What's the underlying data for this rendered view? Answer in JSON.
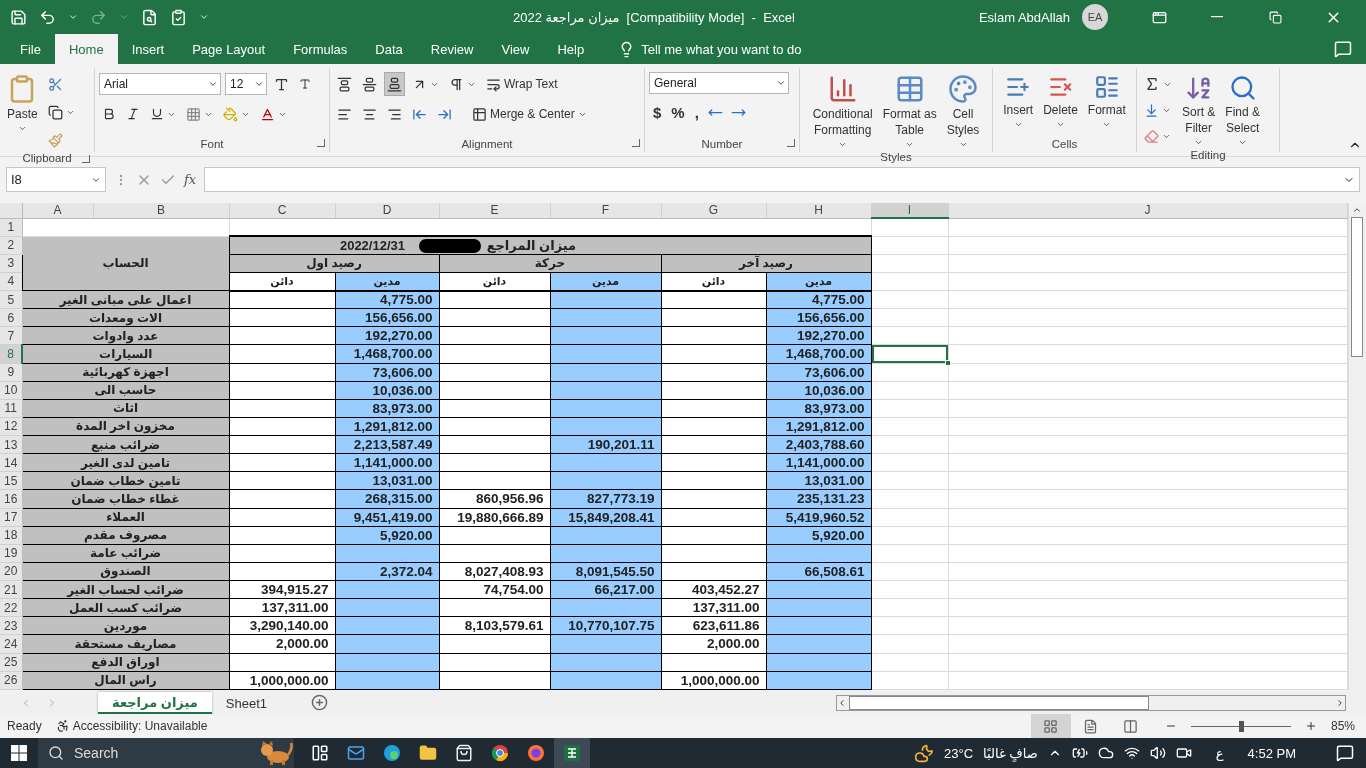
{
  "title_bar": {
    "title": "ميزان مراجعة 2022  [Compatibility Mode]  -  Excel",
    "user": "Eslam AbdAllah",
    "avatar": "EA",
    "redo_disabled": true
  },
  "menu": {
    "tabs": [
      {
        "label": "File",
        "selected": false
      },
      {
        "label": "Home",
        "selected": true
      },
      {
        "label": "Insert",
        "selected": false
      },
      {
        "label": "Page Layout",
        "selected": false
      },
      {
        "label": "Formulas",
        "selected": false
      },
      {
        "label": "Data",
        "selected": false
      },
      {
        "label": "Review",
        "selected": false
      },
      {
        "label": "View",
        "selected": false
      },
      {
        "label": "Help",
        "selected": false
      }
    ],
    "tell_me": "Tell me what you want to do"
  },
  "ribbon": {
    "clipboard": {
      "paste": "Paste",
      "label": "Clipboard",
      "launcher": true
    },
    "font": {
      "font_name": "Arial",
      "font_size": "12",
      "label": "Font",
      "launcher": true
    },
    "alignment": {
      "vertical": [
        {
          "selected": false
        },
        {
          "selected": false
        },
        {
          "selected": true
        }
      ],
      "wrap_text": "Wrap Text",
      "merge": "Merge & Center",
      "label": "Alignment",
      "launcher": true
    },
    "number": {
      "format": "General",
      "symbols": [
        "$",
        "%",
        ","
      ],
      "label": "Number",
      "launcher": true
    },
    "styles": {
      "buttons": [
        {
          "kind": "conditional",
          "lines": [
            "Conditional",
            "Formatting"
          ]
        },
        {
          "kind": "table",
          "lines": [
            "Format as",
            "Table"
          ]
        },
        {
          "kind": "cell",
          "lines": [
            "Cell",
            "Styles"
          ]
        }
      ],
      "label": "Styles"
    },
    "cells": {
      "buttons": [
        {
          "kind": "insert",
          "lines": [
            "Insert"
          ]
        },
        {
          "kind": "delete",
          "lines": [
            "Delete"
          ]
        },
        {
          "kind": "format",
          "lines": [
            "Format"
          ]
        }
      ],
      "label": "Cells"
    },
    "editing": {
      "buttons": [
        {
          "kind": "sort",
          "lines": [
            "Sort &",
            "Filter"
          ]
        },
        {
          "kind": "find",
          "lines": [
            "Find &",
            "Select"
          ]
        }
      ],
      "label": "Editing"
    }
  },
  "formula_bar": {
    "name_box": "I8",
    "fx": "fx"
  },
  "columns": [
    {
      "label": "A",
      "selected": false
    },
    {
      "label": "B",
      "selected": false
    },
    {
      "label": "C",
      "selected": false
    },
    {
      "label": "D",
      "selected": false
    },
    {
      "label": "E",
      "selected": false
    },
    {
      "label": "F",
      "selected": false
    },
    {
      "label": "G",
      "selected": false
    },
    {
      "label": "H",
      "selected": false
    },
    {
      "label": "I",
      "selected": true
    },
    {
      "label": "J",
      "selected": false
    }
  ],
  "sheet": {
    "title_right": "ميزان المراجع",
    "title_date": "2022/12/31",
    "account_header": "الحساب",
    "groups": [
      "رصيد آخر",
      "حركة",
      "رصيد اول"
    ],
    "subheaders": [
      "مدين",
      "دائن",
      "مدين",
      "دائن",
      "مدين",
      "دائن"
    ]
  },
  "rows": [
    {
      "number": "1",
      "selected": false
    },
    {
      "number": "2",
      "selected": false
    },
    {
      "number": "3",
      "selected": false
    },
    {
      "number": "4",
      "selected": false
    },
    {
      "number": "5",
      "selected": false,
      "account": "اعمال على مبانى الغير",
      "cells": {
        "D": "4,775.00",
        "H": "4,775.00"
      }
    },
    {
      "number": "6",
      "selected": false,
      "account": "الات ومعدات",
      "cells": {
        "D": "156,656.00",
        "H": "156,656.00"
      }
    },
    {
      "number": "7",
      "selected": false,
      "account": "عدد وادوات",
      "cells": {
        "D": "192,270.00",
        "H": "192,270.00"
      }
    },
    {
      "number": "8",
      "selected": true,
      "account": "السيارات",
      "cells": {
        "D": "1,468,700.00",
        "H": "1,468,700.00"
      }
    },
    {
      "number": "9",
      "selected": false,
      "account": "اجهزة كهربائية",
      "cells": {
        "D": "73,606.00",
        "H": "73,606.00"
      }
    },
    {
      "number": "10",
      "selected": false,
      "account": "حاسب الى",
      "cells": {
        "D": "10,036.00",
        "H": "10,036.00"
      }
    },
    {
      "number": "11",
      "selected": false,
      "account": "اثاث",
      "cells": {
        "D": "83,973.00",
        "H": "83,973.00"
      }
    },
    {
      "number": "12",
      "selected": false,
      "account": "مخزون اخر المدة",
      "cells": {
        "D": "1,291,812.00",
        "H": "1,291,812.00"
      }
    },
    {
      "number": "13",
      "selected": false,
      "account": "ضرائب منبع",
      "cells": {
        "D": "2,213,587.49",
        "F": "190,201.11",
        "H": "2,403,788.60"
      }
    },
    {
      "number": "14",
      "selected": false,
      "account": "تامين لدى الغير",
      "cells": {
        "D": "1,141,000.00",
        "H": "1,141,000.00"
      }
    },
    {
      "number": "15",
      "selected": false,
      "account": "تامين خطاب ضمان",
      "cells": {
        "D": "13,031.00",
        "H": "13,031.00"
      }
    },
    {
      "number": "16",
      "selected": false,
      "account": "غطاء خطاب ضمان",
      "cells": {
        "D": "268,315.00",
        "E": "860,956.96",
        "F": "827,773.19",
        "H": "235,131.23"
      }
    },
    {
      "number": "17",
      "selected": false,
      "account": "العملاء",
      "cells": {
        "D": "9,451,419.00",
        "E": "19,880,666.89",
        "F": "15,849,208.41",
        "H": "5,419,960.52"
      }
    },
    {
      "number": "18",
      "selected": false,
      "account": "مصروف مقدم",
      "cells": {
        "D": "5,920.00",
        "H": "5,920.00"
      }
    },
    {
      "number": "19",
      "selected": false,
      "account": "ضرائب عامة"
    },
    {
      "number": "20",
      "selected": false,
      "account": "الصندوق",
      "cells": {
        "D": "2,372.04",
        "E": "8,027,408.93",
        "F": "8,091,545.50",
        "H": "66,508.61"
      }
    },
    {
      "number": "21",
      "selected": false,
      "account": "ضرائب لحساب الغير",
      "cells": {
        "C": "394,915.27",
        "E": "74,754.00",
        "F": "66,217.00",
        "G": "403,452.27"
      }
    },
    {
      "number": "22",
      "selected": false,
      "account": "ضرائب كسب العمل",
      "cells": {
        "C": "137,311.00",
        "G": "137,311.00"
      }
    },
    {
      "number": "23",
      "selected": false,
      "account": "موردين",
      "cells": {
        "C": "3,290,140.00",
        "E": "8,103,579.61",
        "F": "10,770,107.75",
        "G": "623,611.86"
      }
    },
    {
      "number": "24",
      "selected": false,
      "account": "مصاريف مستحقة",
      "cells": {
        "C": "2,000.00",
        "G": "2,000.00"
      }
    },
    {
      "number": "25",
      "selected": false,
      "account": "اوراق الدفع"
    },
    {
      "number": "26",
      "selected": false,
      "account": "راس المال",
      "cells": {
        "C": "1,000,000.00",
        "G": "1,000,000.00"
      }
    }
  ],
  "sheet_tabs": [
    {
      "label": "ميزان مراجعة",
      "selected": true
    },
    {
      "label": "Sheet1",
      "selected": false
    }
  ],
  "status_bar": {
    "status": "Ready",
    "accessibility": "Accessibility: Unavailable",
    "views": [
      {
        "kind": "normal",
        "selected": true
      },
      {
        "kind": "page_layout",
        "selected": false
      },
      {
        "kind": "page_break",
        "selected": false
      }
    ],
    "zoom": {
      "level": 0.5,
      "reading": "85%"
    }
  },
  "taskbar": {
    "search": "Search",
    "apps": [
      {
        "kind": "task_view",
        "active": false
      },
      {
        "kind": "mail",
        "active": false
      },
      {
        "kind": "edge",
        "active": false
      },
      {
        "kind": "folder",
        "active": false
      },
      {
        "kind": "store",
        "active": false
      },
      {
        "kind": "chrome",
        "active": false
      },
      {
        "kind": "firefox",
        "active": false
      },
      {
        "kind": "excel",
        "active": true
      }
    ],
    "temperature": "23°C",
    "weather": "صافٍ غالبًا",
    "language": "ع",
    "time": "4:52 PM"
  }
}
